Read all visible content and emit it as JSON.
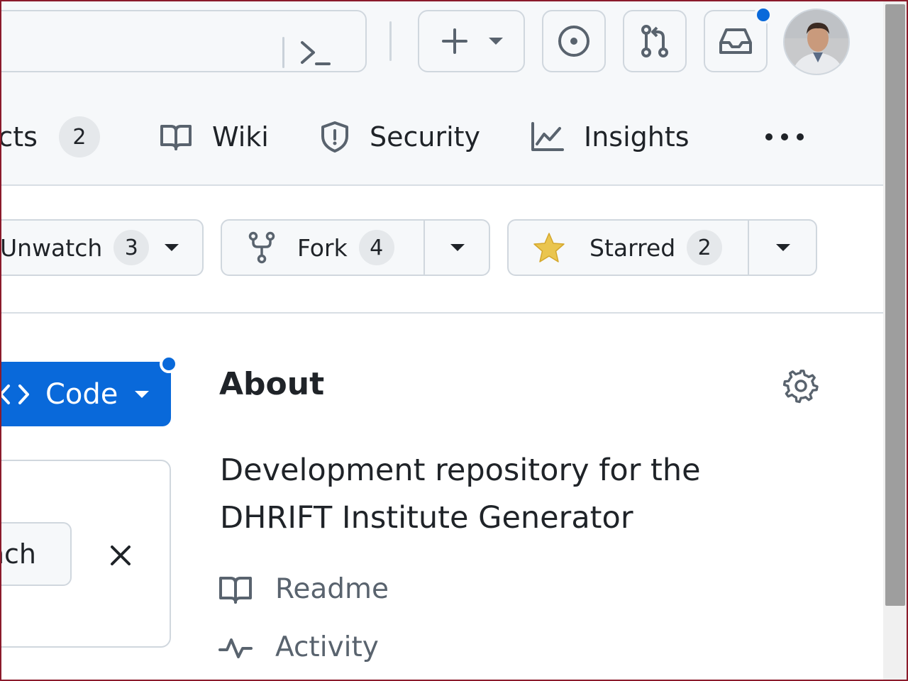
{
  "header": {
    "command_palette_label": "Command palette",
    "create_label": "Create new",
    "issues_label": "Issues",
    "pulls_label": "Pull requests",
    "inbox_label": "Inbox",
    "has_notification": true
  },
  "tabs": [
    {
      "label": "ects",
      "counter": "2",
      "icon": "table-icon"
    },
    {
      "label": "Wiki",
      "icon": "book-icon"
    },
    {
      "label": "Security",
      "icon": "shield-icon"
    },
    {
      "label": "Insights",
      "icon": "graph-icon"
    }
  ],
  "actions": {
    "unwatch": {
      "label": "Unwatch",
      "count": "3"
    },
    "fork": {
      "label": "Fork",
      "count": "4"
    },
    "star": {
      "label": "Starred",
      "count": "2"
    }
  },
  "code_button": {
    "label": "Code"
  },
  "panel": {
    "chip_label": "nch"
  },
  "about": {
    "title": "About",
    "description": "Development repository for the DHRIFT Institute Generator",
    "links": [
      {
        "label": "Readme",
        "icon": "book-icon"
      },
      {
        "label": "Activity",
        "icon": "pulse-icon"
      }
    ]
  },
  "colors": {
    "accent": "#0969da",
    "header_bg": "#f6f8fa",
    "border": "#d0d7de",
    "star": "#eac54f",
    "muted_text": "#59636e"
  }
}
